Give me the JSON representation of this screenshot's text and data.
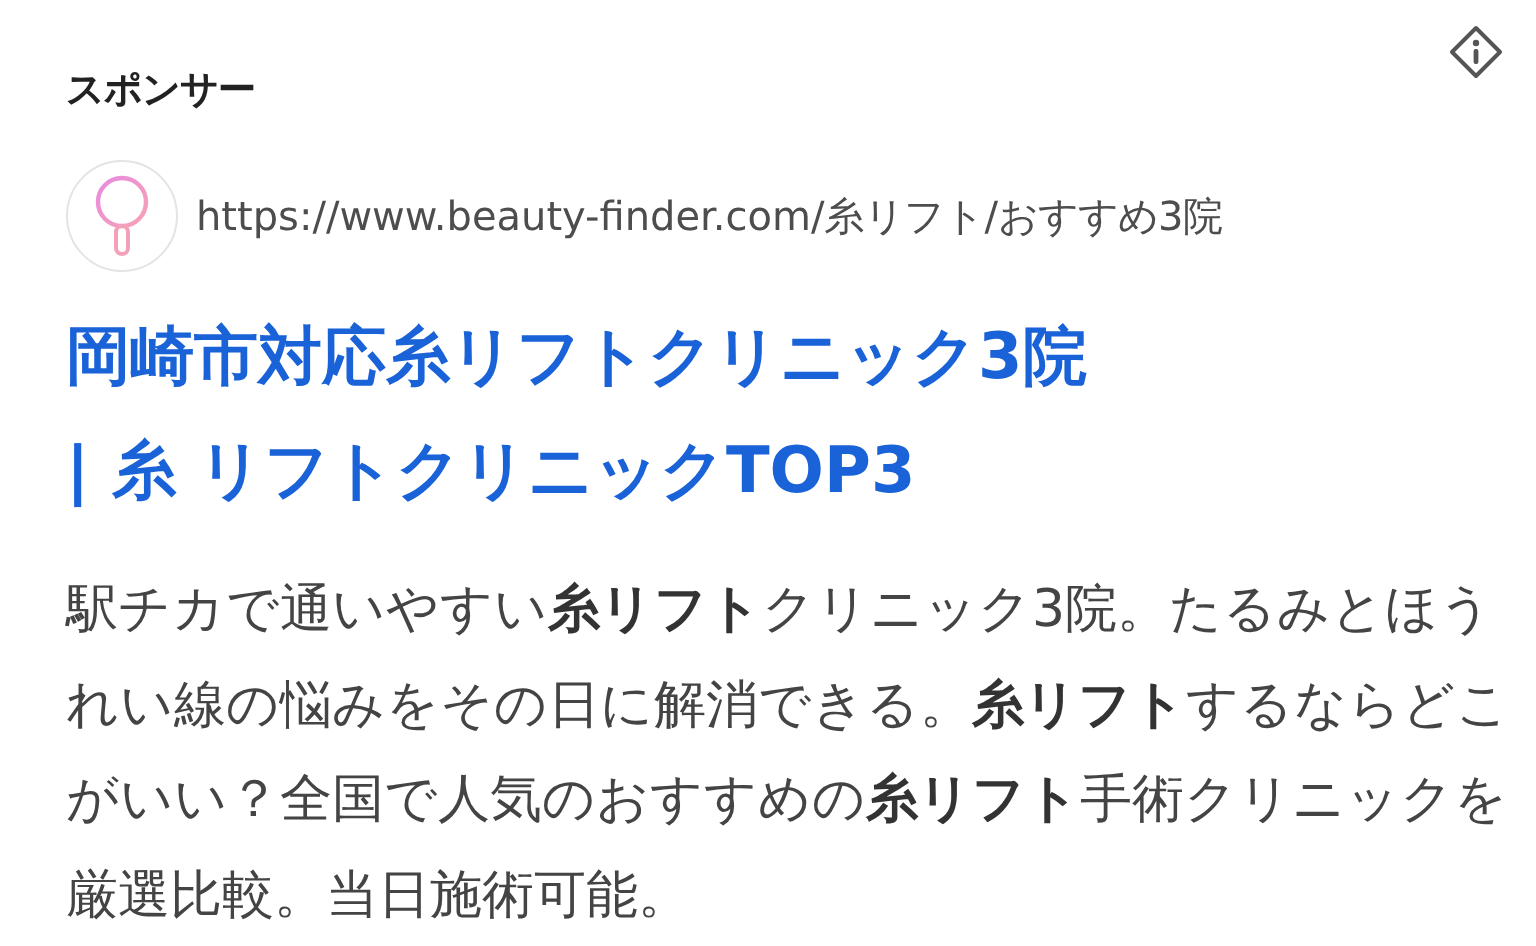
{
  "ad_label": "スポンサー",
  "site": {
    "url": "https://www.beauty-finder.com/糸リフト/おすすめ3院"
  },
  "title": "岡崎市対応糸リフトクリニック3院 | 糸 リフトクリニックTOP3",
  "description": "駅チカで通いやすい**糸リフト**クリニック3院。たるみとほうれい線の悩みをその日に解消できる。**糸リフト**するならどこがいい？全国で人気のおすすめの**糸リフト**手術クリニックを厳選比較。当日施術可能。"
}
